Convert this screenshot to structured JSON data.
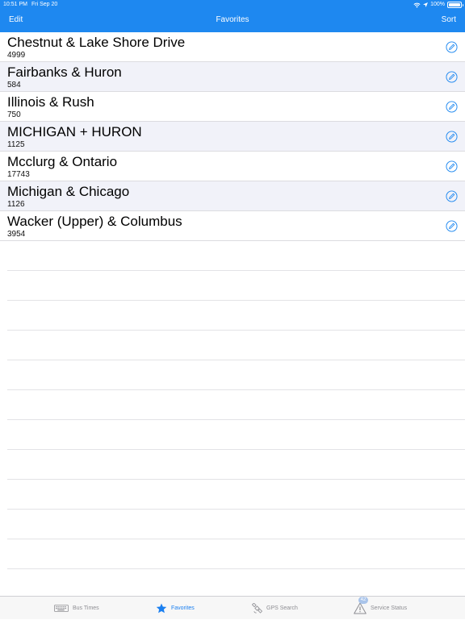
{
  "status_bar": {
    "time": "10:51 PM",
    "date": "Fri Sep 20",
    "battery": "100%"
  },
  "nav": {
    "left_label": "Edit",
    "title": "Favorites",
    "right_label": "Sort"
  },
  "favorites": [
    {
      "name": "Chestnut & Lake Shore Drive",
      "stop_id": "4999"
    },
    {
      "name": "Fairbanks & Huron",
      "stop_id": "584"
    },
    {
      "name": "Illinois & Rush",
      "stop_id": "750"
    },
    {
      "name": "MICHIGAN + HURON",
      "stop_id": "1125"
    },
    {
      "name": "Mcclurg & Ontario",
      "stop_id": "17743"
    },
    {
      "name": "Michigan & Chicago",
      "stop_id": "1126"
    },
    {
      "name": "Wacker (Upper) & Columbus",
      "stop_id": "3954"
    }
  ],
  "tabs": [
    {
      "label": "Bus Times",
      "icon": "keyboard-icon",
      "active": false
    },
    {
      "label": "Favorites",
      "icon": "star-icon",
      "active": true
    },
    {
      "label": "GPS Search",
      "icon": "satellite-icon",
      "active": false
    },
    {
      "label": "Service Status",
      "icon": "warning-icon",
      "active": false,
      "badge": "42"
    }
  ],
  "colors": {
    "accent": "#1e88f0",
    "active_tab": "#1a7ff0",
    "inactive_tab": "#8e8e93",
    "alt_row": "#f1f2f9"
  }
}
